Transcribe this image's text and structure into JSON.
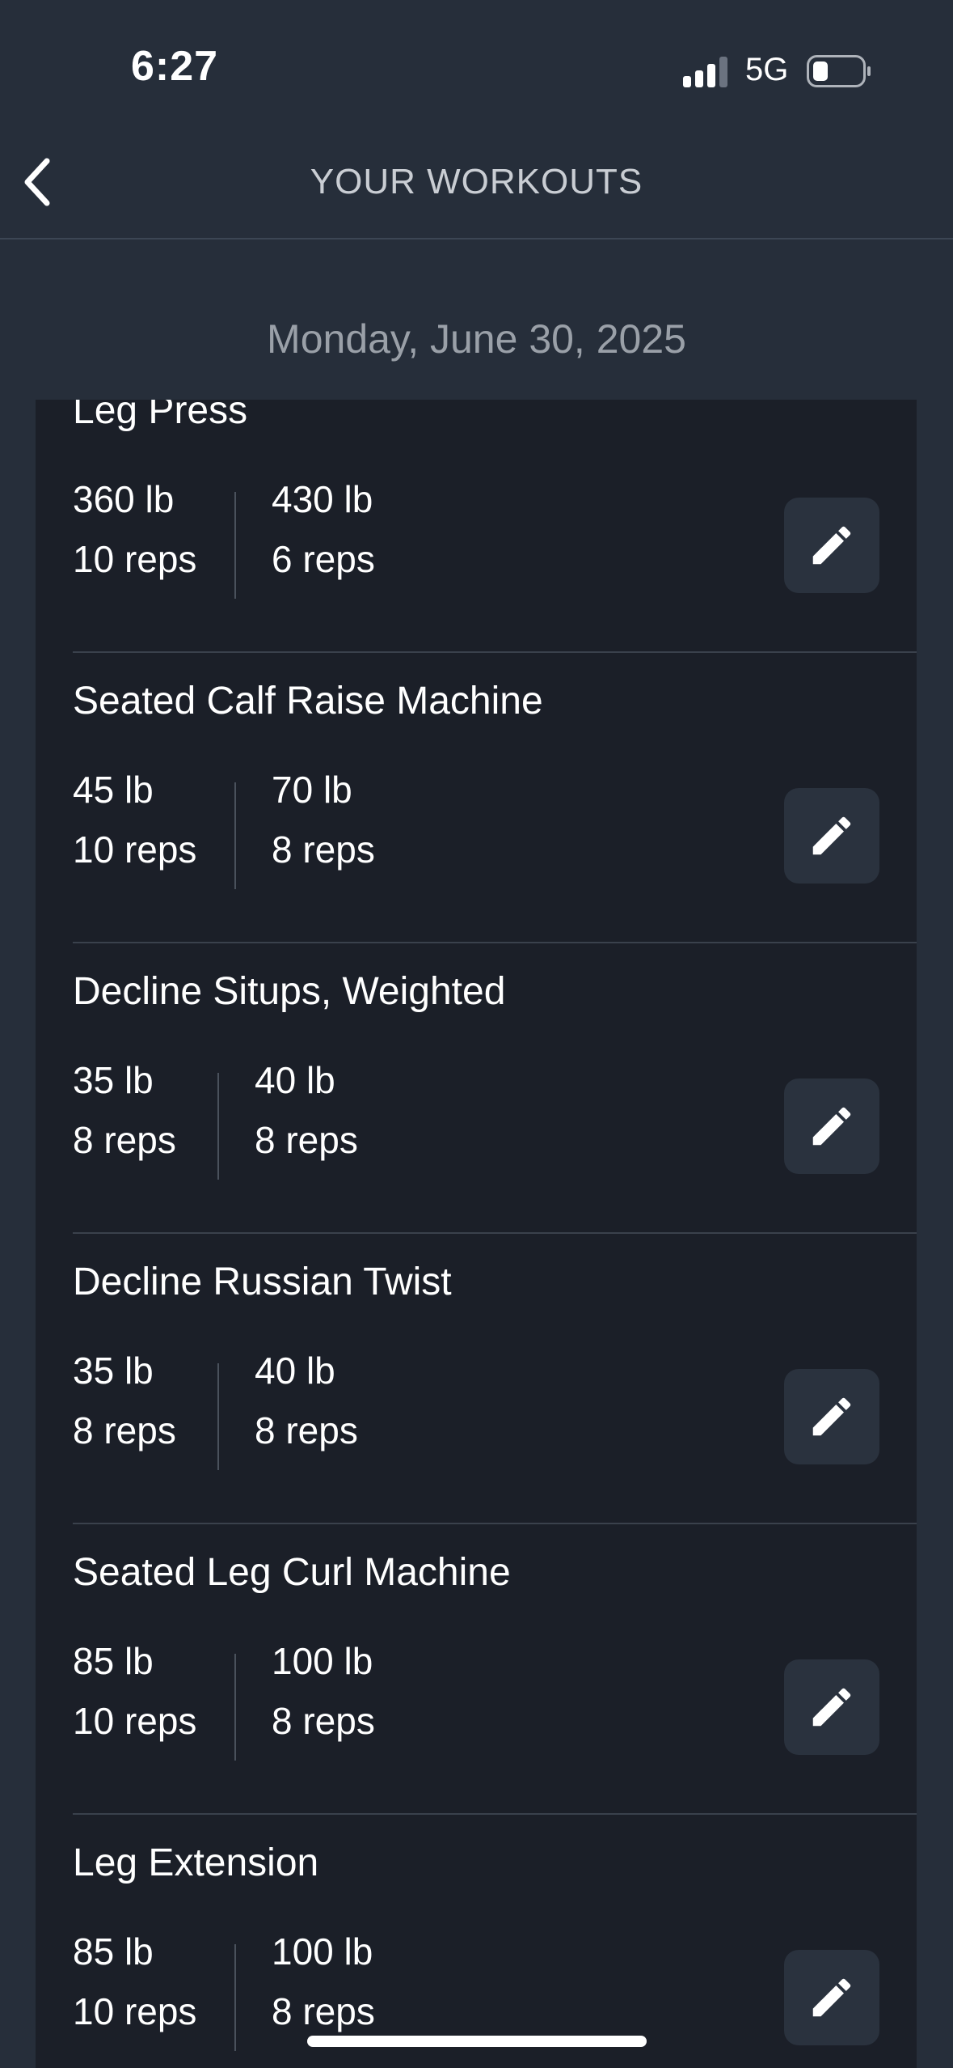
{
  "status_bar": {
    "time": "6:27",
    "network": "5G",
    "signal_icon": "cellular-signal-icon",
    "battery_icon": "battery-icon"
  },
  "header": {
    "title": "YOUR WORKOUTS",
    "back_icon": "chevron-left-icon"
  },
  "date": "Monday, June 30, 2025",
  "workouts": [
    {
      "name": "Leg Press",
      "sets": [
        {
          "weight": "360 lb",
          "reps": "10 reps"
        },
        {
          "weight": "430 lb",
          "reps": "6 reps"
        }
      ]
    },
    {
      "name": "Seated Calf Raise Machine",
      "sets": [
        {
          "weight": "45 lb",
          "reps": "10 reps"
        },
        {
          "weight": "70 lb",
          "reps": "8 reps"
        }
      ]
    },
    {
      "name": "Decline Situps, Weighted",
      "sets": [
        {
          "weight": "35 lb",
          "reps": "8 reps"
        },
        {
          "weight": "40 lb",
          "reps": "8 reps"
        }
      ]
    },
    {
      "name": "Decline Russian Twist",
      "sets": [
        {
          "weight": "35 lb",
          "reps": "8 reps"
        },
        {
          "weight": "40 lb",
          "reps": "8 reps"
        }
      ]
    },
    {
      "name": "Seated Leg Curl Machine",
      "sets": [
        {
          "weight": "85 lb",
          "reps": "10 reps"
        },
        {
          "weight": "100 lb",
          "reps": "8 reps"
        }
      ]
    },
    {
      "name": "Leg Extension",
      "sets": [
        {
          "weight": "85 lb",
          "reps": "10 reps"
        },
        {
          "weight": "100 lb",
          "reps": "8 reps"
        }
      ]
    }
  ],
  "edit_icon": "pencil-icon",
  "colors": {
    "background": "#262e3a",
    "panel": "#1b1f28",
    "edit_button": "#2a323e",
    "title_text": "#c9cdd3",
    "date_text": "#9aa0a8"
  }
}
